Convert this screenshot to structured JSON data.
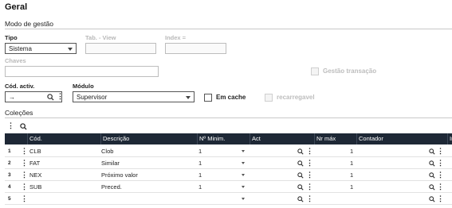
{
  "section_title": "Geral",
  "subsection_title": "Modo de gestão",
  "fields": {
    "tipo_label": "Tipo",
    "tipo_value": "Sistema",
    "tab_view_label": "Tab. - View",
    "index_label": "Index =",
    "chaves_label": "Chaves",
    "gestao_transacao_label": "Gestão transação",
    "cod_activ_label": "Cód. activ.",
    "cod_activ_value": "→",
    "modulo_label": "Módulo",
    "modulo_value": "Supervisor",
    "em_cache_label": "Em cache",
    "recarregavel_label": "recarregavel"
  },
  "colecoes": {
    "title": "Coleções",
    "columns": [
      "Cód.",
      "Descrição",
      "Nº Minim.",
      "Act",
      "Nr máx",
      "Contador",
      "In"
    ],
    "rows": [
      {
        "num": "1",
        "cod": "CLB",
        "descricao": "Clob",
        "minim": "1",
        "nrmax": "1"
      },
      {
        "num": "2",
        "cod": "FAT",
        "descricao": "Similar",
        "minim": "1",
        "nrmax": "1"
      },
      {
        "num": "3",
        "cod": "NEX",
        "descricao": "Próximo valor",
        "minim": "1",
        "nrmax": "1"
      },
      {
        "num": "4",
        "cod": "SUB",
        "descricao": "Preced.",
        "minim": "1",
        "nrmax": "1"
      },
      {
        "num": "5",
        "cod": "",
        "descricao": "",
        "minim": "",
        "nrmax": ""
      }
    ]
  },
  "icons": {
    "search": "search-icon",
    "more": "kebab-icon",
    "dropdown": "chevron-down-icon"
  }
}
